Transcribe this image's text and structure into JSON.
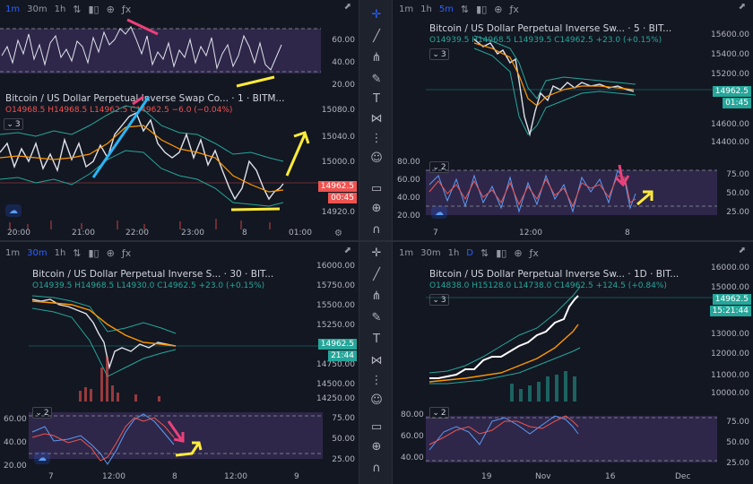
{
  "panes": {
    "tl": {
      "timeframes": [
        "1m",
        "30m",
        "1h"
      ],
      "active_timeframe": "1m",
      "title": "Bitcoin / US Dollar Perpetual Inverse Swap Co... · 1 · BITM...",
      "ohlc": {
        "o": "O14968.5",
        "h": "H14968.5",
        "l": "L14962.5",
        "c": "C14962.5",
        "chg": "−6.0 (−0.04%)"
      },
      "indicator_badge": "3",
      "rsi_axis": [
        "60.00",
        "40.00",
        "20.00"
      ],
      "price_axis": [
        "15080.0",
        "15040.0",
        "15000.0",
        "14920.0"
      ],
      "price_tag": "14962.5",
      "countdown": "00:45",
      "time_axis": [
        "20:00",
        "21:00",
        "22:00",
        "23:00",
        "8",
        "01:00"
      ]
    },
    "tr": {
      "timeframes": [
        "1m",
        "1h",
        "5m"
      ],
      "active_timeframe": "5m",
      "title": "Bitcoin / US Dollar Perpetual Inverse Sw... · 5 · BIT...",
      "ohlc": {
        "o": "O14939.5",
        "h": "H14968.5",
        "l": "L14939.5",
        "c": "C14962.5",
        "chg": "+23.0 (+0.15%)"
      },
      "indicator_badge": "3",
      "osc_badge": "2",
      "price_axis": [
        "15600.00",
        "15400.00",
        "15200.00",
        "14600.00",
        "14400.00"
      ],
      "price_tag": "14962.5",
      "countdown": "01:45",
      "osc_axis_left": [
        "80.00",
        "60.00",
        "40.00",
        "20.00"
      ],
      "osc_axis_right": [
        "75.00",
        "50.00",
        "25.00"
      ],
      "time_axis": [
        "7",
        "12:00",
        "8"
      ]
    },
    "bl": {
      "timeframes": [
        "1m",
        "30m",
        "1h"
      ],
      "active_timeframe": "30m",
      "title": "Bitcoin / US Dollar Perpetual Inverse S... · 30 · BIT...",
      "ohlc": {
        "o": "O14939.5",
        "h": "H14968.5",
        "l": "L14930.0",
        "c": "C14962.5",
        "chg": "+23.0 (+0.15%)"
      },
      "indicator_badge": "3",
      "osc_badge": "2",
      "price_axis": [
        "16000.00",
        "15750.00",
        "15500.00",
        "15250.00",
        "14750.00",
        "14500.00",
        "14250.00"
      ],
      "price_tag": "14962.5",
      "countdown": "21:44",
      "osc_axis_left": [
        "60.00",
        "40.00",
        "20.00"
      ],
      "osc_axis_right": [
        "75.00",
        "50.00",
        "25.00"
      ],
      "time_axis": [
        "7",
        "12:00",
        "8",
        "12:00",
        "9"
      ]
    },
    "br": {
      "timeframes": [
        "1m",
        "30m",
        "1h",
        "D"
      ],
      "active_timeframe": "D",
      "title": "Bitcoin / US Dollar Perpetual Inverse Sw... · 1D · BIT...",
      "ohlc": {
        "o": "O14838.0",
        "h": "H15128.0",
        "l": "L14738.0",
        "c": "C14962.5",
        "chg": "+124.5 (+0.84%)"
      },
      "indicator_badge": "3",
      "osc_badge": "2",
      "price_axis": [
        "16000.00",
        "15000.00",
        "13000.00",
        "12000.00",
        "11000.00",
        "10000.00"
      ],
      "price_tag": "14962.5",
      "countdown": "15:21:44",
      "osc_axis_left": [
        "80.00",
        "60.00",
        "40.00"
      ],
      "osc_axis_right": [
        "75.00",
        "50.00",
        "25.00"
      ],
      "time_axis": [
        "19",
        "Nov",
        "16",
        "Dec"
      ]
    }
  },
  "colors": {
    "up": "#26a69a",
    "down": "#ef5350",
    "accent": "#2962ff",
    "osc_fill": "#7e57c2"
  },
  "toolbar_icons": [
    "crosshair-icon",
    "trendline-icon",
    "fib-icon",
    "brush-icon",
    "text-icon",
    "pattern-icon",
    "prediction-icon",
    "emoji-icon",
    "ruler-icon",
    "zoom-icon",
    "magnet-icon",
    "lock-icon",
    "eye-icon",
    "trash-icon"
  ]
}
